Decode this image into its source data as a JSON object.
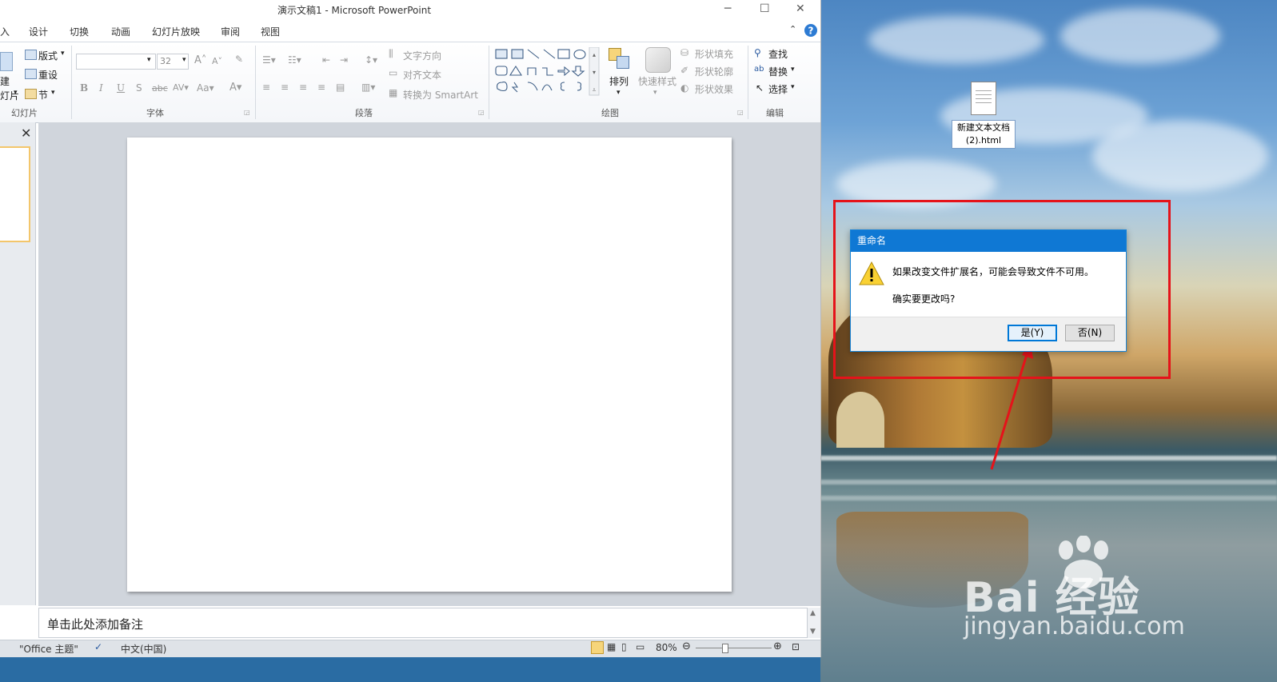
{
  "window": {
    "title": "演示文稿1  -  Microsoft PowerPoint"
  },
  "tabs": [
    "入",
    "设计",
    "切换",
    "动画",
    "幻灯片放映",
    "审阅",
    "视图"
  ],
  "ribbon": {
    "slides": {
      "layout": "版式",
      "reset": "重设",
      "section": "节",
      "new_top": "建",
      "new_bottom": "灯片",
      "label": "幻灯片"
    },
    "font": {
      "size": "32",
      "label": "字体"
    },
    "paragraph": {
      "text_direction": "文字方向",
      "align_text": "对齐文本",
      "smartart": "转换为 SmartArt",
      "label": "段落"
    },
    "drawing": {
      "arrange": "排列",
      "quick_styles": "快速样式",
      "shape_fill": "形状填充",
      "shape_outline": "形状轮廓",
      "shape_effects": "形状效果",
      "label": "绘图"
    },
    "editing": {
      "find": "查找",
      "replace": "替换",
      "select": "选择",
      "label": "编辑"
    }
  },
  "notes": {
    "placeholder": "单击此处添加备注"
  },
  "status": {
    "theme": "\"Office 主题\"",
    "language": "中文(中国)",
    "zoom": "80%"
  },
  "desktop": {
    "file_icon_label_1": "新建文本文档",
    "file_icon_label_2": "(2).html"
  },
  "dialog": {
    "title": "重命名",
    "message": "如果改变文件扩展名，可能会导致文件不可用。",
    "question": "确实要更改吗?",
    "yes": "是(Y)",
    "no": "否(N)"
  },
  "watermark": {
    "brand": "Bai   经验",
    "url": "jingyan.baidu.com"
  },
  "colors": {
    "dialog_title_bar": "#0f78d4",
    "highlight_box": "#e5131a",
    "yes_button_border": "#0078d7"
  }
}
